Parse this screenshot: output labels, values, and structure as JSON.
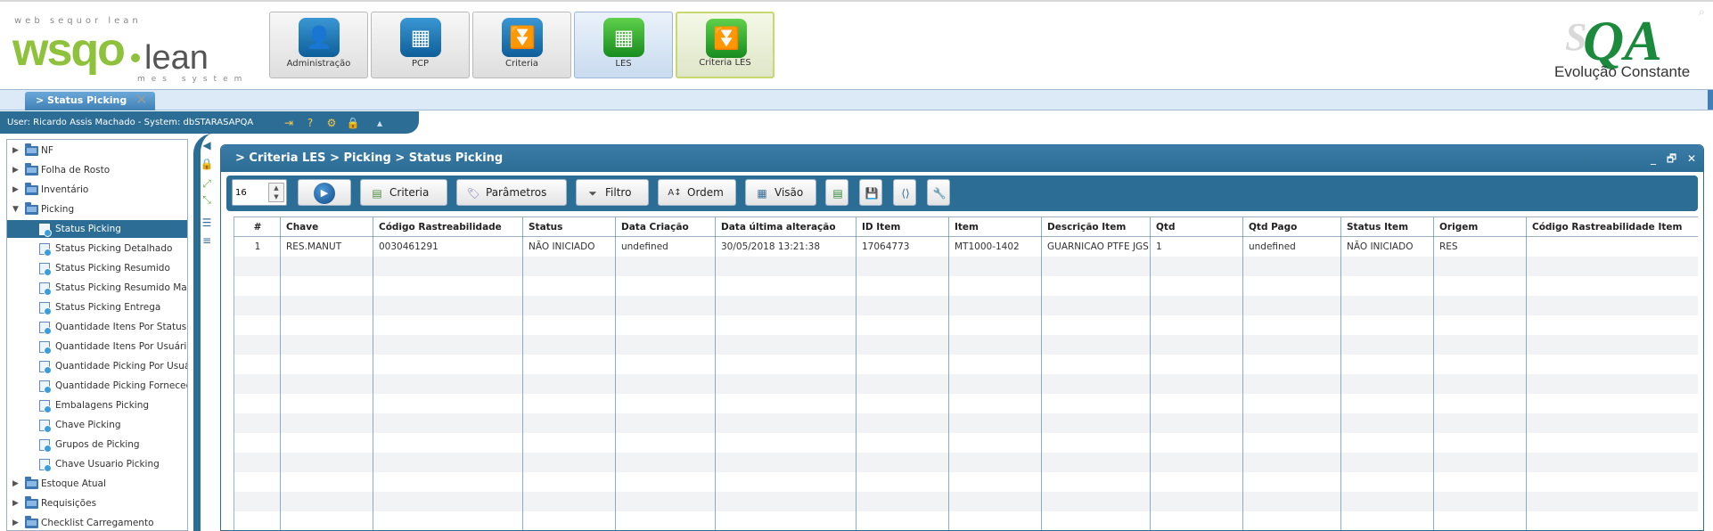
{
  "brand": {
    "tagline": "web sequor lean",
    "logo_mark": "wsqo",
    "logo_lean": "lean",
    "logo_sub": "mes system",
    "qa_mark": "QA",
    "qa_s": "S",
    "qa_slogan": "Evolução Constante",
    "green": "#8fc23c",
    "blue": "#2d7fb1"
  },
  "modules": [
    {
      "label": "Administração",
      "icon": "person-icon",
      "color": "blue"
    },
    {
      "label": "PCP",
      "icon": "calendar-icon",
      "color": "blue"
    },
    {
      "label": "Criteria",
      "icon": "filter-funnel-icon",
      "color": "blue"
    },
    {
      "label": "LES",
      "icon": "grid-icon",
      "color": "green"
    },
    {
      "label": "Criteria LES",
      "icon": "filter-funnel-icon",
      "color": "green"
    }
  ],
  "tab": {
    "label": "> Status Picking"
  },
  "userbar": {
    "text": "User: Ricardo Assis Machado - System: dbSTARASAPQA"
  },
  "tree": {
    "folders_top": [
      "NF",
      "Folha de Rosto",
      "Inventário"
    ],
    "open_folder": "Picking",
    "children": [
      "Status Picking",
      "Status Picking Detalhado",
      "Status Picking Resumido",
      "Status Picking Resumido Mar",
      "Status Picking Entrega",
      "Quantidade Itens Por Status",
      "Quantidade Itens Por Usuário",
      "Quantidade Picking Por Usuá",
      "Quantidade Picking Forneced",
      "Embalagens Picking",
      "Chave Picking",
      "Grupos de Picking",
      "Chave Usuario Picking"
    ],
    "selected_child": "Status Picking",
    "folders_bottom": [
      "Estoque Atual",
      "Requisições",
      "Checklist Carregamento"
    ]
  },
  "main": {
    "title": "> Criteria LES > Picking > Status Picking",
    "win_controls": [
      "_",
      "🗗",
      "✕"
    ],
    "page_size": "16",
    "buttons": {
      "criteria": "Criteria",
      "parametros": "Parâmetros",
      "filtro": "Filtro",
      "ordem": "Ordem",
      "visao": "Visão"
    }
  },
  "grid": {
    "columns": [
      "#",
      "Chave",
      "Código Rastreabilidade",
      "Status",
      "Data Criação",
      "Data última alteração",
      "ID Item",
      "Item",
      "Descrição Item",
      "Qtd",
      "Qtd Pago",
      "Status Item",
      "Origem",
      "Código Rastreabilidade Item"
    ],
    "rows": [
      [
        "1",
        "RES.MANUT",
        "0030461291",
        "NÃO INICIADO",
        "undefined",
        "30/05/2018 13:21:38",
        "17064773",
        "MT1000-1402",
        "GUARNICAO PTFE JGS",
        "1",
        "undefined",
        "NÃO INICIADO",
        "RES",
        ""
      ]
    ]
  },
  "colors": {
    "primary": "#2c6d96",
    "tab_strip": "#dbeaf6",
    "row_alt": "#f1f3f5"
  }
}
